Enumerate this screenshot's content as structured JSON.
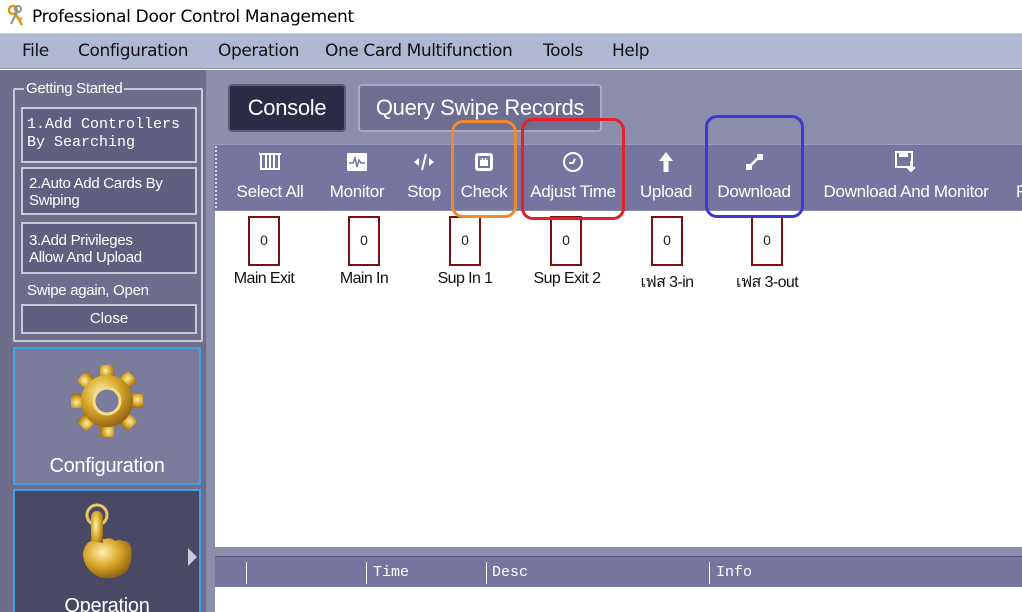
{
  "window": {
    "title": "Professional Door Control Management"
  },
  "menu": [
    "File",
    "Configuration",
    "Operation",
    "One Card Multifunction",
    "Tools",
    "Help"
  ],
  "getting_started": {
    "legend": "Getting Started",
    "step1_line1": "1.Add Controllers",
    "step1_line2": "By Searching",
    "step2_line1": "2.Auto Add Cards By",
    "step2_line2": "Swiping",
    "step3_line1": "3.Add Privileges",
    "step3_line2": "Allow And Upload",
    "hint": "Swipe again, Open",
    "close": "Close"
  },
  "nav": {
    "configuration": "Configuration",
    "operation": "Operation"
  },
  "tabs": {
    "console": "Console",
    "query": "Query Swipe Records"
  },
  "toolbar": [
    "Select All",
    "Monitor",
    "Stop",
    "Check",
    "Adjust Time",
    "Upload",
    "Download",
    "Download And Monitor"
  ],
  "doors": [
    {
      "name": "Main Exit",
      "count": "0"
    },
    {
      "name": "Main In",
      "count": "0"
    },
    {
      "name": "Sup  In 1",
      "count": "0"
    },
    {
      "name": "Sup Exit 2",
      "count": "0"
    },
    {
      "name": "เฟส 3-in",
      "count": "0"
    },
    {
      "name": "เฟส 3-out",
      "count": "0"
    }
  ],
  "grid_columns": [
    "Time",
    "Desc",
    "Info"
  ],
  "colors": {
    "highlight_check": "#f08a2e",
    "highlight_adjust_time": "#e4202a",
    "highlight_download": "#3a3ad0"
  }
}
